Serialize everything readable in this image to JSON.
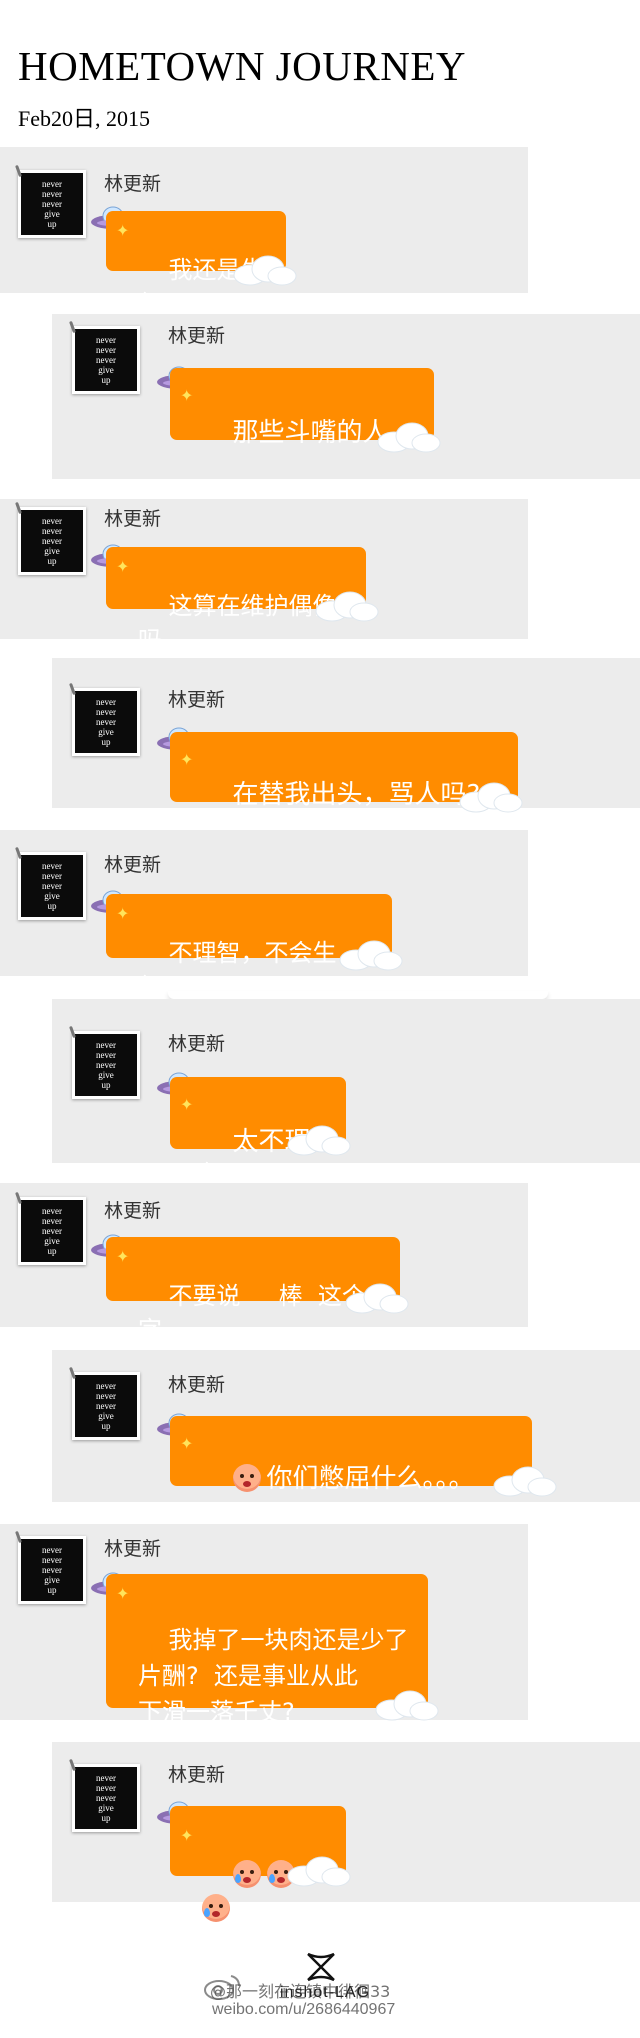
{
  "header": {
    "title": "HOMETOWN JOURNEY",
    "date": "Feb20日, 2015"
  },
  "avatar_text": [
    "never",
    "never",
    "never",
    "give",
    "up"
  ],
  "messages": [
    {
      "sender": "林更新",
      "text": "我还是生气"
    },
    {
      "sender": "林更新",
      "text": "那些斗嘴的人，"
    },
    {
      "sender": "林更新",
      "text": "这算在维护偶像吗"
    },
    {
      "sender": "林更新",
      "text": "在替我出头，骂人吗?"
    },
    {
      "sender": "林更新",
      "text": "不理智，不会生气，"
    },
    {
      "sender": "林更新",
      "text": "太不理智"
    },
    {
      "sender": "林更新",
      "text": "不要说     棒  这个字"
    },
    {
      "sender": "林更新",
      "text": "你们憋屈什么。。。",
      "emoji": "scared-face"
    },
    {
      "sender": "林更新",
      "text": "我掉了一块肉还是少了\n片酬?  还是事业从此\n下滑一落千丈?"
    },
    {
      "sender": "林更新",
      "text": "",
      "emoji": "crying-face x3"
    }
  ],
  "footer": {
    "brand": "inshot-LAG",
    "weibo_handle": "@那一刻在连镇中徘徊33",
    "weibo_url": "weibo.com/u/2686440967"
  },
  "colors": {
    "bubble": "#ff8c00",
    "card_background": "#ececec",
    "page_background": "#ffffff"
  }
}
